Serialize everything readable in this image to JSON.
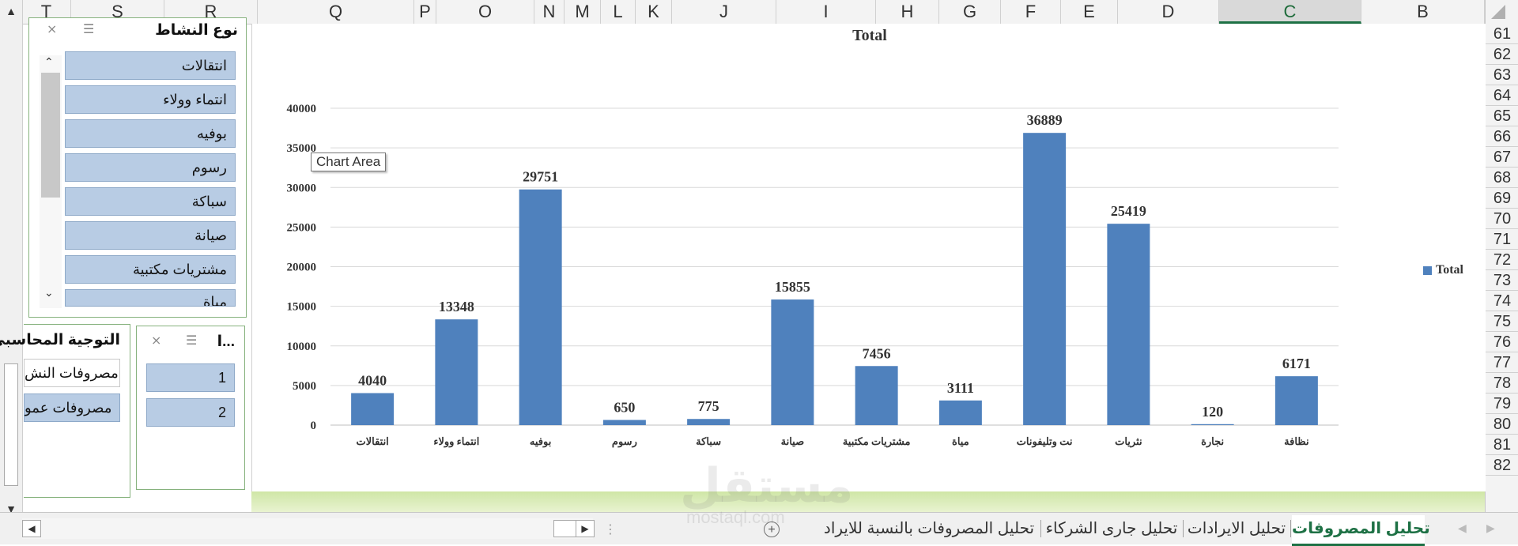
{
  "columns": [
    "T",
    "S",
    "R",
    "Q",
    "P",
    "O",
    "N",
    "M",
    "L",
    "K",
    "J",
    "I",
    "H",
    "G",
    "F",
    "E",
    "D",
    "C",
    "B"
  ],
  "selected_column": "C",
  "rows": [
    "61",
    "62",
    "63",
    "64",
    "65",
    "66",
    "67",
    "68",
    "69",
    "70",
    "71",
    "72",
    "73",
    "74",
    "75",
    "76",
    "77",
    "78",
    "79",
    "80",
    "81",
    "82"
  ],
  "chart": {
    "tooltip": "Chart Area",
    "legend": "Total"
  },
  "chart_data": {
    "type": "bar",
    "title": "Total",
    "categories": [
      "انتقالات",
      "انتماء وولاء",
      "بوفيه",
      "رسوم",
      "سباكة",
      "صيانة",
      "مشتريات مكتبية",
      "مياة",
      "نت وتليفونات",
      "نثريات",
      "نجارة",
      "نظافة"
    ],
    "series": [
      {
        "name": "Total",
        "values": [
          4040,
          13348,
          29751,
          650,
          775,
          15855,
          7456,
          3111,
          36889,
          25419,
          120,
          6171
        ]
      }
    ],
    "ylim": [
      0,
      40000
    ],
    "yticks": [
      0,
      5000,
      10000,
      15000,
      20000,
      25000,
      30000,
      35000,
      40000
    ],
    "grid": true,
    "legend_position": "right",
    "bar_color": "#4f81bd"
  },
  "slicer_activity": {
    "title": "نوع النشاط",
    "items": [
      "انتقالات",
      "انتماء وولاء",
      "بوفيه",
      "رسوم",
      "سباكة",
      "صيانة",
      "مشتريات مكتبية",
      "مياة"
    ]
  },
  "slicer_number": {
    "title": "ا...",
    "items": [
      "1",
      "2"
    ]
  },
  "slicer_accounting": {
    "title": "التوجية المحاسبي",
    "items": [
      "مصروفات النش",
      "مصروفات عمو"
    ]
  },
  "sheets": [
    "تحليل المصروفات",
    "تحليل الايرادات",
    "تحليل جارى الشركاء",
    "تحليل المصروفات بالنسبة للايراد"
  ],
  "active_sheet": "تحليل المصروفات",
  "watermark": "مستقل",
  "watermark_sub": "mostaql.com"
}
